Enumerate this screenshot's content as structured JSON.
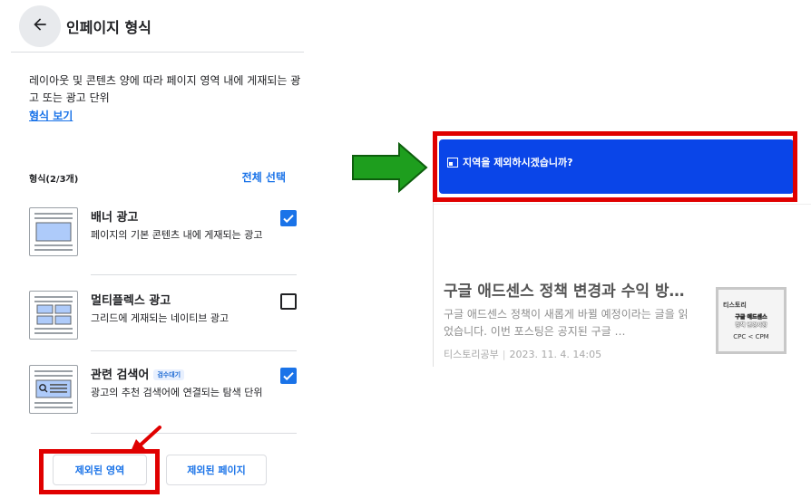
{
  "header": {
    "title": "인페이지 형식",
    "back_icon": "arrow-left-icon"
  },
  "description": "레이아웃 및 콘텐츠 양에 따라 페이지 영역 내에 게재되는 광고 또는 광고 단위",
  "view_formats_link": "형식 보기",
  "formats_section": {
    "count_label": "형식(2/3개)",
    "select_all_label": "전체 선택"
  },
  "formats": [
    {
      "name": "배너 광고",
      "description": "페이지의 기본 콘텐츠 내에 게재되는 광고",
      "checked": true,
      "badge": ""
    },
    {
      "name": "멀티플렉스 광고",
      "description": "그리드에 게재되는 네이티브 광고",
      "checked": false,
      "badge": ""
    },
    {
      "name": "관련 검색어",
      "description": "광고의 추천 검색어에 연결되는 탐색 단위",
      "checked": true,
      "badge": "검수대기"
    }
  ],
  "buttons": {
    "excluded_areas": "제외된 영역",
    "excluded_pages": "제외된 페이지"
  },
  "preview": {
    "banner_text": "지역을 제외하시겠습니까?",
    "post_title": "구글 애드센스 정책 변경과 수익 방…",
    "post_excerpt": "구글 애드센스 정책이 새롭게 바뀔 예정이라는 글을 읽었습니다. 이번 포스팅은 공지된 구글 …",
    "post_author": "티스토리공부",
    "post_date": "2023. 11. 4. 14:05",
    "thumbnail": {
      "line1": "티스토리",
      "line2": "구글 애드센스",
      "line3": "정책 변경사항",
      "line4": "CPC < CPM"
    }
  },
  "colors": {
    "accent_blue": "#1a73e8",
    "highlight_red": "#e00000",
    "arrow_green": "#1e9e1e",
    "banner_blue": "#0a45e8"
  }
}
